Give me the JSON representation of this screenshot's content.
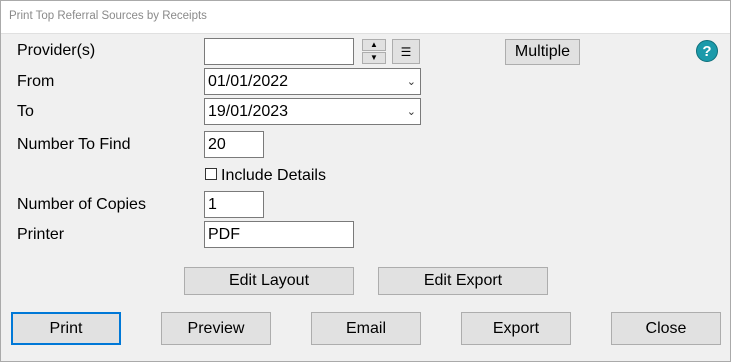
{
  "window": {
    "title": "Print Top Referral Sources by Receipts"
  },
  "labels": {
    "providers": "Provider(s)",
    "from": "From",
    "to": "To",
    "number_to_find": "Number To Find",
    "include_details": "Include Details",
    "number_of_copies": "Number of Copies",
    "printer": "Printer"
  },
  "fields": {
    "providers": "",
    "from": "01/01/2022",
    "to": "19/01/2023",
    "number_to_find": "20",
    "number_of_copies": "1",
    "printer": "PDF"
  },
  "include_details_checked": false,
  "buttons": {
    "multiple": "Multiple",
    "edit_layout": "Edit Layout",
    "edit_export": "Edit Export",
    "print": "Print",
    "preview": "Preview",
    "email": "Email",
    "export": "Export",
    "close": "Close"
  },
  "icons": {
    "help": "question-icon",
    "spin_up": "arrow-up-icon",
    "spin_down": "arrow-down-icon",
    "list": "list-icon",
    "chevron": "chevron-down-icon"
  },
  "colors": {
    "accent": "#0078d7",
    "help": "#1b9aaa"
  }
}
